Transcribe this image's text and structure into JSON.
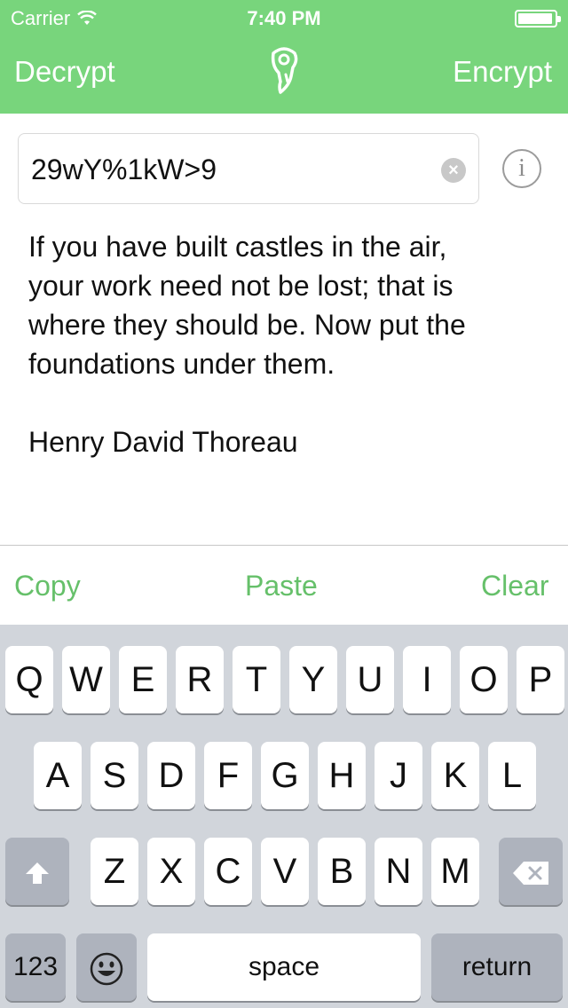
{
  "status_bar": {
    "carrier": "Carrier",
    "time": "7:40 PM",
    "battery_level": 0.95
  },
  "nav": {
    "left_label": "Decrypt",
    "right_label": "Encrypt",
    "logo_icon": "key-lock-icon"
  },
  "key_field": {
    "value": "29wY%1kW>9"
  },
  "message": {
    "text": "If you have built castles in the air,\nyour work need not be lost; that is\nwhere they should be. Now put the\nfoundations under them.\n\nHenry David Thoreau"
  },
  "toolbar": {
    "copy_label": "Copy",
    "paste_label": "Paste",
    "clear_label": "Clear"
  },
  "keyboard": {
    "row1": [
      "Q",
      "W",
      "E",
      "R",
      "T",
      "Y",
      "U",
      "I",
      "O",
      "P"
    ],
    "row2": [
      "A",
      "S",
      "D",
      "F",
      "G",
      "H",
      "J",
      "K",
      "L"
    ],
    "row3": [
      "Z",
      "X",
      "C",
      "V",
      "B",
      "N",
      "M"
    ],
    "numbers_label": "123",
    "space_label": "space",
    "return_label": "return"
  },
  "colors": {
    "accent": "#78d57c",
    "action_text": "#66c06a"
  }
}
